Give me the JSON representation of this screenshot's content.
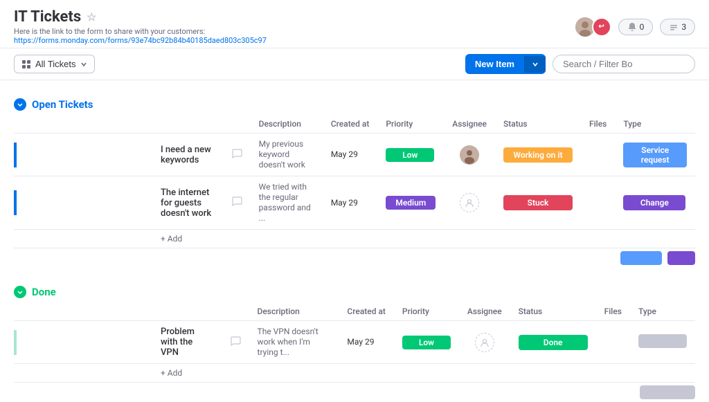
{
  "page": {
    "title": "IT Tickets",
    "form_label": "Here is the link to the form to share with your customers:",
    "form_url": "https://forms.monday.com/forms/93e74bc92b84b40185daed803c305c97",
    "notifications_count": "0",
    "activity_count": "3"
  },
  "toolbar": {
    "view_label": "All Tickets",
    "new_item_label": "New Item",
    "search_placeholder": "Search / Filter Bo"
  },
  "open_group": {
    "title": "Open Tickets",
    "columns": {
      "name": "",
      "description": "Description",
      "created_at": "Created at",
      "priority": "Priority",
      "assignee": "Assignee",
      "status": "Status",
      "files": "Files",
      "type": "Type"
    },
    "rows": [
      {
        "id": 1,
        "name": "I need a new keywords",
        "description": "My previous keyword doesn't work",
        "created_at": "May 29",
        "priority": "Low",
        "priority_class": "priority-low",
        "has_assignee": true,
        "status": "Working on it",
        "status_class": "status-working",
        "type": "Service request",
        "type_class": "type-service"
      },
      {
        "id": 2,
        "name": "The internet for guests doesn't work",
        "description": "We tried with the regular password and ...",
        "created_at": "May 29",
        "priority": "Medium",
        "priority_class": "priority-medium",
        "has_assignee": false,
        "status": "Stuck",
        "status_class": "status-stuck",
        "type": "Change",
        "type_class": "type-change"
      }
    ],
    "add_label": "+ Add"
  },
  "done_group": {
    "title": "Done",
    "columns": {
      "name": "",
      "description": "Description",
      "created_at": "Created at",
      "priority": "Priority",
      "assignee": "Assignee",
      "status": "Status",
      "files": "Files",
      "type": "Type"
    },
    "rows": [
      {
        "id": 3,
        "name": "Problem with the VPN",
        "description": "The VPN doesn't work when I'm trying t...",
        "created_at": "May 29",
        "priority": "Low",
        "priority_class": "priority-low",
        "has_assignee": false,
        "status": "Done",
        "status_class": "status-done",
        "type": "",
        "type_class": ""
      }
    ],
    "add_label": "+ Add"
  },
  "icons": {
    "star": "☆",
    "chevron_down": "▾",
    "grid": "⊞",
    "comment": "💬",
    "notifications": "🔔",
    "invite": "👤",
    "search": "🔍"
  }
}
